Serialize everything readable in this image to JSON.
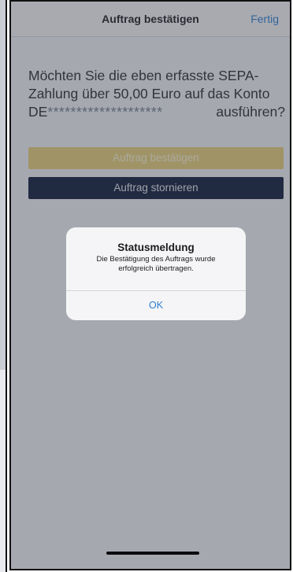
{
  "navbar": {
    "title": "Auftrag bestätigen",
    "done_label": "Fertig"
  },
  "question": {
    "line1": "Möchten Sie die eben erfasste SEPA-",
    "line2": "Zahlung über 50,00 Euro auf das Konto",
    "iban_prefix": "DE",
    "iban_masked": "********************",
    "line3_end": "ausführen?"
  },
  "buttons": {
    "confirm_label": "Auftrag bestätigen",
    "cancel_label": "Auftrag stornieren"
  },
  "alert": {
    "title": "Statusmeldung",
    "message_line1": "Die Bestätigung des Auftrags wurde",
    "message_line2": "erfolgreich übertragen.",
    "ok_label": "OK"
  },
  "colors": {
    "accent_blue": "#2f7fd1",
    "confirm_button": "#e8d07a",
    "cancel_button": "#0d1a3a"
  }
}
